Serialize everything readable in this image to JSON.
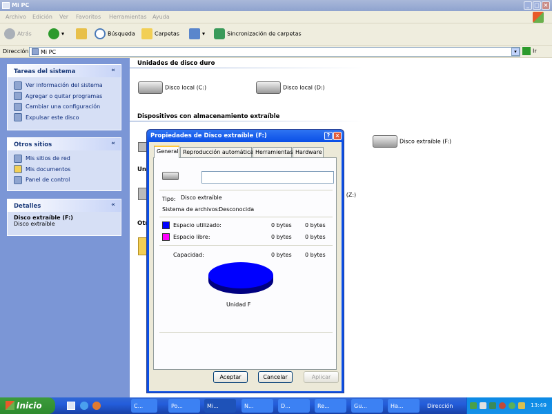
{
  "window": {
    "title": "Mi PC"
  },
  "menu": [
    "Archivo",
    "Edición",
    "Ver",
    "Favoritos",
    "Herramientas",
    "Ayuda"
  ],
  "toolbar": {
    "back": "Atrás",
    "search": "Búsqueda",
    "folders": "Carpetas",
    "sync": "Sincronización de carpetas"
  },
  "address": {
    "label": "Dirección",
    "value": "Mi PC",
    "go": "Ir"
  },
  "sidebar": {
    "system_tasks": {
      "title": "Tareas del sistema",
      "items": [
        "Ver información del sistema",
        "Agregar o quitar programas",
        "Cambiar una configuración",
        "Expulsar este disco"
      ]
    },
    "other_places": {
      "title": "Otros sitios",
      "items": [
        "Mis sitios de red",
        "Mis documentos",
        "Panel de control"
      ]
    },
    "details": {
      "title": "Detalles",
      "name": "Disco extraíble (F:)",
      "type": "Disco extraíble"
    }
  },
  "main": {
    "hard_disks_title": "Unidades de disco duro",
    "drive_c": "Disco local (C:)",
    "drive_d": "Disco local (D:)",
    "removable_title": "Dispositivos con almacenamiento extraíble",
    "drive_f": "Disco extraíble (F:)",
    "partial_uni": "Uni",
    "partial_otr": "Otr",
    "partial_z": "' (Z:)"
  },
  "dialog": {
    "title": "Propiedades de Disco extraíble (F:)",
    "tabs": [
      "General",
      "Reproducción automática",
      "Herramientas",
      "Hardware"
    ],
    "name_value": "",
    "type_label": "Tipo:",
    "type_value": "Disco extraíble",
    "fs_label": "Sistema de archivos:",
    "fs_value": "Desconocida",
    "used_label": "Espacio utilizado:",
    "used_bytes1": "0 bytes",
    "used_bytes2": "0 bytes",
    "free_label": "Espacio libre:",
    "free_bytes1": "0 bytes",
    "free_bytes2": "0 bytes",
    "capacity_label": "Capacidad:",
    "cap_bytes1": "0 bytes",
    "cap_bytes2": "0 bytes",
    "drive_caption": "Unidad F",
    "used_color": "#0000ff",
    "free_color": "#ff00ff",
    "ok": "Aceptar",
    "cancel": "Cancelar",
    "apply": "Aplicar"
  },
  "taskbar": {
    "start": "Inicio",
    "items": [
      "C...",
      "Po...",
      "Mi...",
      "N...",
      "D...",
      "Re...",
      "Gu...",
      "Ha...",
      "Dirección"
    ],
    "clock": "13:49"
  }
}
